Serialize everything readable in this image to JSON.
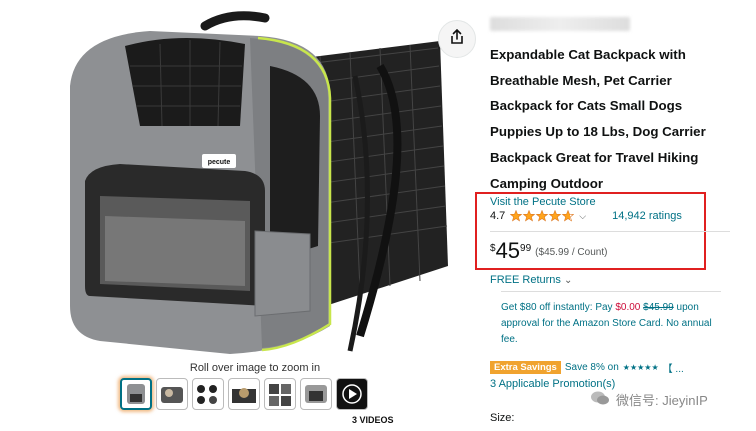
{
  "product": {
    "title": "Expandable Cat Backpack with Breathable Mesh, Pet Carrier Backpack for Cats Small Dogs Puppies Up to 18 Lbs, Dog Carrier Backpack Great for Travel Hiking Camping Outdoor",
    "store_link": "Visit the Pecute Store",
    "rating": "4.7",
    "stars_value": 4.7,
    "ratings_count": "14,942 ratings",
    "price_symbol": "$",
    "price_whole": "45",
    "price_fraction": "99",
    "price_per_unit": "($45.99 / Count)",
    "returns": "FREE Returns",
    "returns_chevron": "⌄",
    "logo_text": "pecute"
  },
  "offer": {
    "prefix": "Get $80 off instantly: Pay ",
    "new_price": "$0.00",
    "old_price": "$45.99",
    "suffix": " upon approval for the Amazon Store Card. No annual fee."
  },
  "extra_savings": {
    "badge": "Extra Savings",
    "text": "Save 8% on",
    "stars_glyph": "★★★★★",
    "bracket": "【 ..."
  },
  "promotions": "3 Applicable Promotion(s)",
  "size_label": "Size:",
  "gallery": {
    "zoom_hint": "Roll over image to zoom in",
    "videos_label": "3 VIDEOS",
    "thumbnails": [
      "thumb-1",
      "thumb-2",
      "thumb-3",
      "thumb-4",
      "thumb-5",
      "thumb-6",
      "thumb-7"
    ]
  },
  "watermark": "微信号: JieyinIP",
  "colors": {
    "link": "#007185",
    "star": "#FFA41C",
    "highlight": "#e02020",
    "accent_green": "#c8e64c"
  },
  "icons": {
    "share": "share-icon",
    "play": "play-icon",
    "star": "star-icon",
    "wechat": "wechat-icon"
  }
}
